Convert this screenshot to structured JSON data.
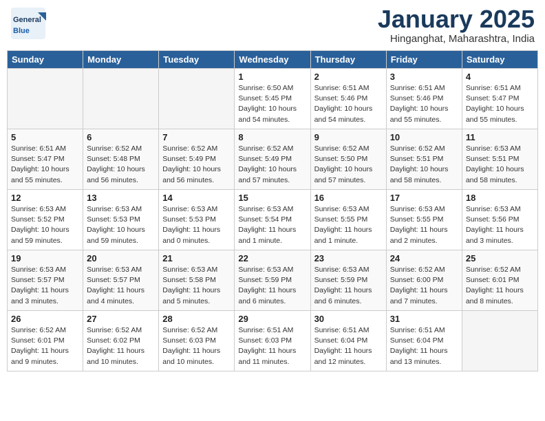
{
  "header": {
    "logo_line1": "General",
    "logo_line2": "Blue",
    "title": "January 2025",
    "location": "Hinganghat, Maharashtra, India"
  },
  "days_of_week": [
    "Sunday",
    "Monday",
    "Tuesday",
    "Wednesday",
    "Thursday",
    "Friday",
    "Saturday"
  ],
  "weeks": [
    [
      {
        "num": "",
        "info": ""
      },
      {
        "num": "",
        "info": ""
      },
      {
        "num": "",
        "info": ""
      },
      {
        "num": "1",
        "info": "Sunrise: 6:50 AM\nSunset: 5:45 PM\nDaylight: 10 hours\nand 54 minutes."
      },
      {
        "num": "2",
        "info": "Sunrise: 6:51 AM\nSunset: 5:46 PM\nDaylight: 10 hours\nand 54 minutes."
      },
      {
        "num": "3",
        "info": "Sunrise: 6:51 AM\nSunset: 5:46 PM\nDaylight: 10 hours\nand 55 minutes."
      },
      {
        "num": "4",
        "info": "Sunrise: 6:51 AM\nSunset: 5:47 PM\nDaylight: 10 hours\nand 55 minutes."
      }
    ],
    [
      {
        "num": "5",
        "info": "Sunrise: 6:51 AM\nSunset: 5:47 PM\nDaylight: 10 hours\nand 55 minutes."
      },
      {
        "num": "6",
        "info": "Sunrise: 6:52 AM\nSunset: 5:48 PM\nDaylight: 10 hours\nand 56 minutes."
      },
      {
        "num": "7",
        "info": "Sunrise: 6:52 AM\nSunset: 5:49 PM\nDaylight: 10 hours\nand 56 minutes."
      },
      {
        "num": "8",
        "info": "Sunrise: 6:52 AM\nSunset: 5:49 PM\nDaylight: 10 hours\nand 57 minutes."
      },
      {
        "num": "9",
        "info": "Sunrise: 6:52 AM\nSunset: 5:50 PM\nDaylight: 10 hours\nand 57 minutes."
      },
      {
        "num": "10",
        "info": "Sunrise: 6:52 AM\nSunset: 5:51 PM\nDaylight: 10 hours\nand 58 minutes."
      },
      {
        "num": "11",
        "info": "Sunrise: 6:53 AM\nSunset: 5:51 PM\nDaylight: 10 hours\nand 58 minutes."
      }
    ],
    [
      {
        "num": "12",
        "info": "Sunrise: 6:53 AM\nSunset: 5:52 PM\nDaylight: 10 hours\nand 59 minutes."
      },
      {
        "num": "13",
        "info": "Sunrise: 6:53 AM\nSunset: 5:53 PM\nDaylight: 10 hours\nand 59 minutes."
      },
      {
        "num": "14",
        "info": "Sunrise: 6:53 AM\nSunset: 5:53 PM\nDaylight: 11 hours\nand 0 minutes."
      },
      {
        "num": "15",
        "info": "Sunrise: 6:53 AM\nSunset: 5:54 PM\nDaylight: 11 hours\nand 1 minute."
      },
      {
        "num": "16",
        "info": "Sunrise: 6:53 AM\nSunset: 5:55 PM\nDaylight: 11 hours\nand 1 minute."
      },
      {
        "num": "17",
        "info": "Sunrise: 6:53 AM\nSunset: 5:55 PM\nDaylight: 11 hours\nand 2 minutes."
      },
      {
        "num": "18",
        "info": "Sunrise: 6:53 AM\nSunset: 5:56 PM\nDaylight: 11 hours\nand 3 minutes."
      }
    ],
    [
      {
        "num": "19",
        "info": "Sunrise: 6:53 AM\nSunset: 5:57 PM\nDaylight: 11 hours\nand 3 minutes."
      },
      {
        "num": "20",
        "info": "Sunrise: 6:53 AM\nSunset: 5:57 PM\nDaylight: 11 hours\nand 4 minutes."
      },
      {
        "num": "21",
        "info": "Sunrise: 6:53 AM\nSunset: 5:58 PM\nDaylight: 11 hours\nand 5 minutes."
      },
      {
        "num": "22",
        "info": "Sunrise: 6:53 AM\nSunset: 5:59 PM\nDaylight: 11 hours\nand 6 minutes."
      },
      {
        "num": "23",
        "info": "Sunrise: 6:53 AM\nSunset: 5:59 PM\nDaylight: 11 hours\nand 6 minutes."
      },
      {
        "num": "24",
        "info": "Sunrise: 6:52 AM\nSunset: 6:00 PM\nDaylight: 11 hours\nand 7 minutes."
      },
      {
        "num": "25",
        "info": "Sunrise: 6:52 AM\nSunset: 6:01 PM\nDaylight: 11 hours\nand 8 minutes."
      }
    ],
    [
      {
        "num": "26",
        "info": "Sunrise: 6:52 AM\nSunset: 6:01 PM\nDaylight: 11 hours\nand 9 minutes."
      },
      {
        "num": "27",
        "info": "Sunrise: 6:52 AM\nSunset: 6:02 PM\nDaylight: 11 hours\nand 10 minutes."
      },
      {
        "num": "28",
        "info": "Sunrise: 6:52 AM\nSunset: 6:03 PM\nDaylight: 11 hours\nand 10 minutes."
      },
      {
        "num": "29",
        "info": "Sunrise: 6:51 AM\nSunset: 6:03 PM\nDaylight: 11 hours\nand 11 minutes."
      },
      {
        "num": "30",
        "info": "Sunrise: 6:51 AM\nSunset: 6:04 PM\nDaylight: 11 hours\nand 12 minutes."
      },
      {
        "num": "31",
        "info": "Sunrise: 6:51 AM\nSunset: 6:04 PM\nDaylight: 11 hours\nand 13 minutes."
      },
      {
        "num": "",
        "info": ""
      }
    ]
  ]
}
